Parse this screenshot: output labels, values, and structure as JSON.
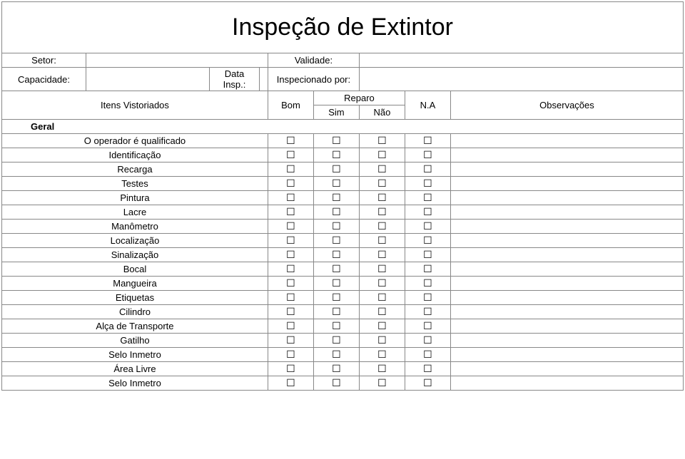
{
  "title": "Inspeção de Extintor",
  "header": {
    "setor_label": "Setor:",
    "setor_value": "",
    "validade_label": "Validade:",
    "validade_value": "",
    "capacidade_label": "Capacidade:",
    "capacidade_value": "",
    "data_insp_label": "Data Insp.:",
    "data_insp_value": "",
    "inspecionado_por_label": "Inspecionado por:",
    "inspecionado_por_value": ""
  },
  "columns": {
    "itens": "Itens Vistoriados",
    "bom": "Bom",
    "reparo": "Reparo",
    "sim": "Sim",
    "nao": "Não",
    "na": "N.A",
    "obs": "Observações"
  },
  "section_geral": "Geral",
  "checkbox_glyph": "☐",
  "items": [
    {
      "label": "O operador é qualificado",
      "obs": ""
    },
    {
      "label": "Identificação",
      "obs": ""
    },
    {
      "label": "Recarga",
      "obs": ""
    },
    {
      "label": "Testes",
      "obs": ""
    },
    {
      "label": "Pintura",
      "obs": ""
    },
    {
      "label": "Lacre",
      "obs": ""
    },
    {
      "label": "Manômetro",
      "obs": ""
    },
    {
      "label": "Localização",
      "obs": ""
    },
    {
      "label": "Sinalização",
      "obs": ""
    },
    {
      "label": "Bocal",
      "obs": ""
    },
    {
      "label": "Mangueira",
      "obs": ""
    },
    {
      "label": "Etiquetas",
      "obs": ""
    },
    {
      "label": "Cilindro",
      "obs": ""
    },
    {
      "label": "Alça de Transporte",
      "obs": ""
    },
    {
      "label": "Gatilho",
      "obs": ""
    },
    {
      "label": "Selo Inmetro",
      "obs": ""
    },
    {
      "label": "Área Livre",
      "obs": ""
    },
    {
      "label": "Selo Inmetro",
      "obs": ""
    }
  ]
}
